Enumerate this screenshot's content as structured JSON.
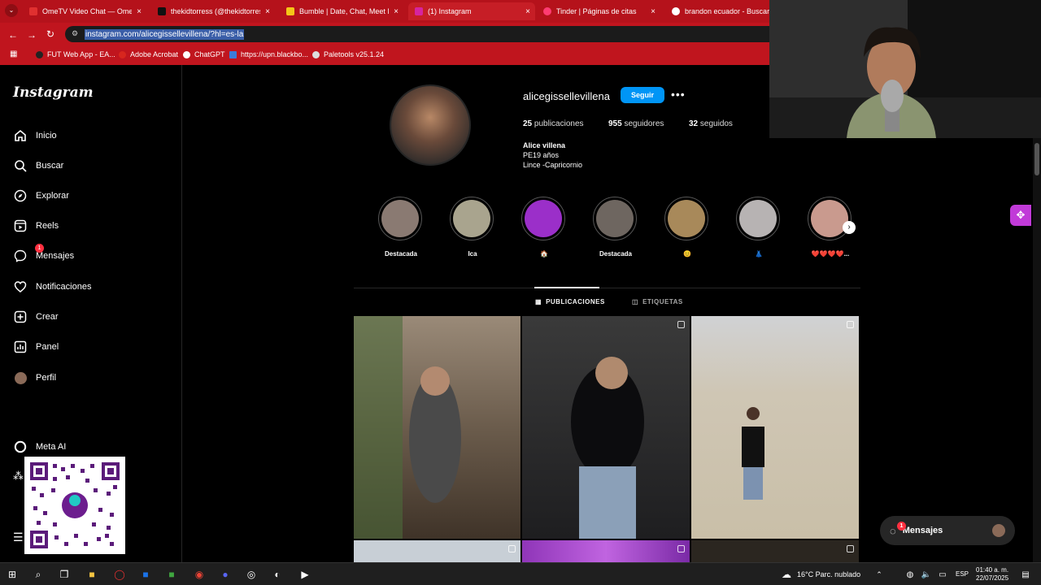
{
  "browser": {
    "tabs": [
      {
        "title": "OmeTV Video Chat — Omegle",
        "color": "#e03030"
      },
      {
        "title": "thekidtorress (@thekidtorress)",
        "color": "#111111"
      },
      {
        "title": "Bumble | Date, Chat, Meet New",
        "color": "#f5c518"
      },
      {
        "title": "(1) Instagram",
        "color": "#d6249f"
      },
      {
        "title": "Tinder | Páginas de citas",
        "color": "#fe3c72"
      },
      {
        "title": "brandon ecuador - Buscar con",
        "color": "#4285f4"
      }
    ],
    "url_host": "instagram.com",
    "url_path": "/alicegissellevillena/?hl=es-la",
    "bookmarks": [
      "FUT Web App - EA...",
      "Adobe Acrobat",
      "ChatGPT",
      "https://upn.blackbo...",
      "Paletools v25.1.24"
    ]
  },
  "sidebar": {
    "logo": "Instagram",
    "items": [
      {
        "label": "Inicio",
        "icon": "home-icon"
      },
      {
        "label": "Buscar",
        "icon": "search-icon"
      },
      {
        "label": "Explorar",
        "icon": "compass-icon"
      },
      {
        "label": "Reels",
        "icon": "reels-icon"
      },
      {
        "label": "Mensajes",
        "icon": "messenger-icon",
        "badge": "1"
      },
      {
        "label": "Notificaciones",
        "icon": "heart-icon"
      },
      {
        "label": "Crear",
        "icon": "plus-square-icon"
      },
      {
        "label": "Panel",
        "icon": "chart-icon"
      },
      {
        "label": "Perfil",
        "icon": "avatar-icon"
      },
      {
        "label": "Meta AI",
        "icon": "meta-ai-icon"
      }
    ]
  },
  "profile": {
    "username": "alicegissellevillena",
    "follow_label": "Seguir",
    "more_label": "•••",
    "posts_count": "25",
    "posts_label": "publicaciones",
    "followers_count": "955",
    "followers_label": "seguidores",
    "following_count": "32",
    "following_label": "seguidos",
    "name": "Alice villena",
    "bio_line1": "PE19 años",
    "bio_line2": "Lince -Capricornio"
  },
  "highlights": [
    {
      "label": "Destacada",
      "color": "#8a7a72"
    },
    {
      "label": "Ica",
      "color": "#a9a48e"
    },
    {
      "label": "🏠",
      "color": "#9b2fc9"
    },
    {
      "label": "Destacada",
      "color": "#6e6660"
    },
    {
      "label": "😊",
      "color": "#a8895a"
    },
    {
      "label": "👗",
      "color": "#b7b3b3"
    },
    {
      "label": "❤️❤️❤️❤️...",
      "color": "#c99a8e"
    }
  ],
  "tabs": {
    "posts": "PUBLICACIONES",
    "tagged": "ETIQUETAS"
  },
  "posts": [
    {
      "color": "#6b5c4c"
    },
    {
      "color": "#2c2c2e"
    },
    {
      "color": "#c9c0ad"
    },
    {
      "color": "#c8cfd6"
    },
    {
      "color": "#8f35b8"
    },
    {
      "color": "#2b2620"
    }
  ],
  "floating": {
    "messages_label": "Mensajes",
    "messages_badge": "1"
  },
  "taskbar": {
    "weather": "16°C  Parc. nublado",
    "lang": "ESP",
    "time": "01:40 a. m.",
    "date": "22/07/2025"
  }
}
